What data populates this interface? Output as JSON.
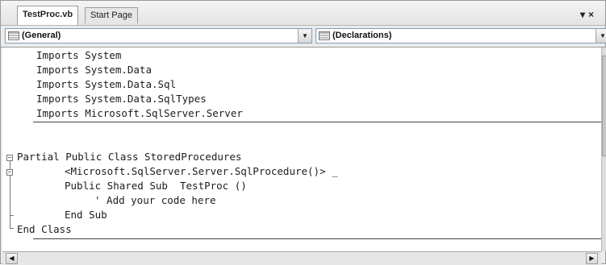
{
  "tabs": [
    {
      "label": "TestProc.vb",
      "active": true
    },
    {
      "label": "Start Page",
      "active": false
    }
  ],
  "tab_controls": {
    "dropdown_glyph": "▾",
    "close_glyph": "×"
  },
  "dropdowns": {
    "object": {
      "selected": "(General)"
    },
    "procedure": {
      "selected": "(Declarations)"
    }
  },
  "code_lines": [
    "Imports System",
    "Imports System.Data",
    "Imports System.Data.Sql",
    "Imports System.Data.SqlTypes",
    "Imports Microsoft.SqlServer.Server",
    "Partial Public Class StoredProcedures",
    "<Microsoft.SqlServer.Server.SqlProcedure()> _",
    "Public Shared Sub  TestProc ()",
    "' Add your code here",
    "End Sub",
    "End Class"
  ],
  "outline": {
    "expanded_glyph": "−"
  },
  "icons": {
    "combo_icon": "class-view-icon",
    "dropdown_arrow": "chevron-down-icon",
    "scroll_left": "arrow-left-icon",
    "scroll_right": "arrow-right-icon"
  },
  "colors": {
    "code_text": "#1c1c1c",
    "editor_bg": "#ffffff",
    "chrome_bg": "#ececec"
  }
}
